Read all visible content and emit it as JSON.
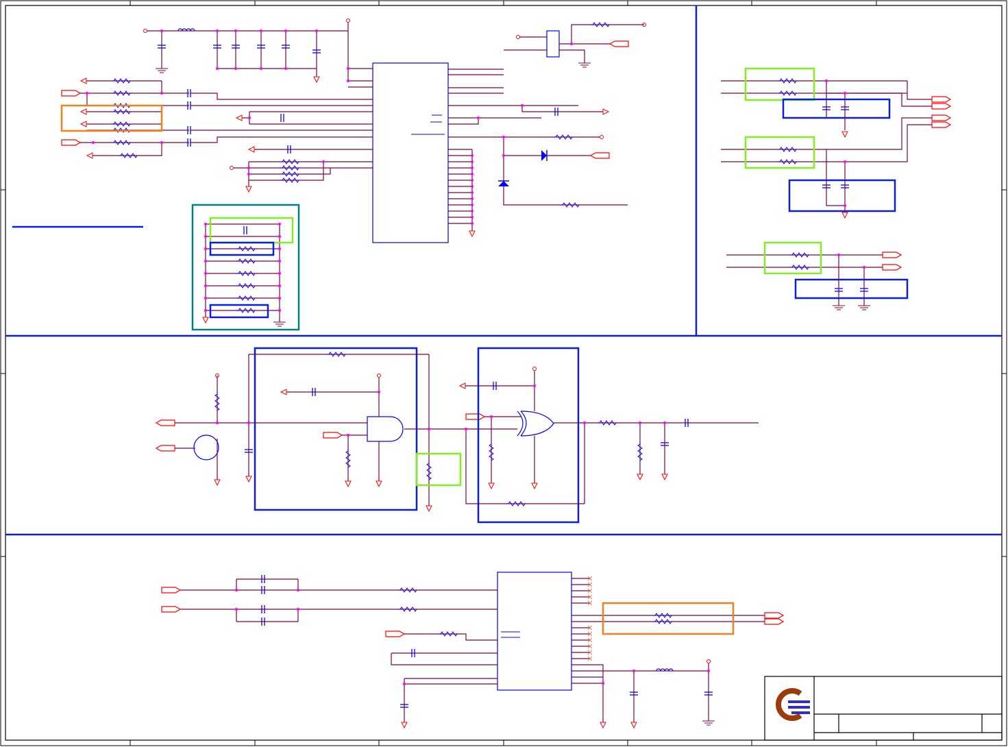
{
  "diagram": {
    "type": "electronic-schematic",
    "sections": [
      "top-left-power-and-ic",
      "top-right-filters",
      "middle-logic-gates",
      "bottom-ic-interface"
    ],
    "title_block": {
      "logo": "company-logo"
    },
    "colors": {
      "wire": "#800040",
      "pin": "#ff0000",
      "component": "#0000ff",
      "junction": "#ff00ff",
      "frame": "#000000",
      "section_divider": "#0a1ee0",
      "highlight_green": "#80f020",
      "highlight_orange": "#f08020",
      "highlight_teal": "#008080",
      "logo_brown": "#9a3c0a",
      "logo_blue": "#3030c0"
    }
  }
}
